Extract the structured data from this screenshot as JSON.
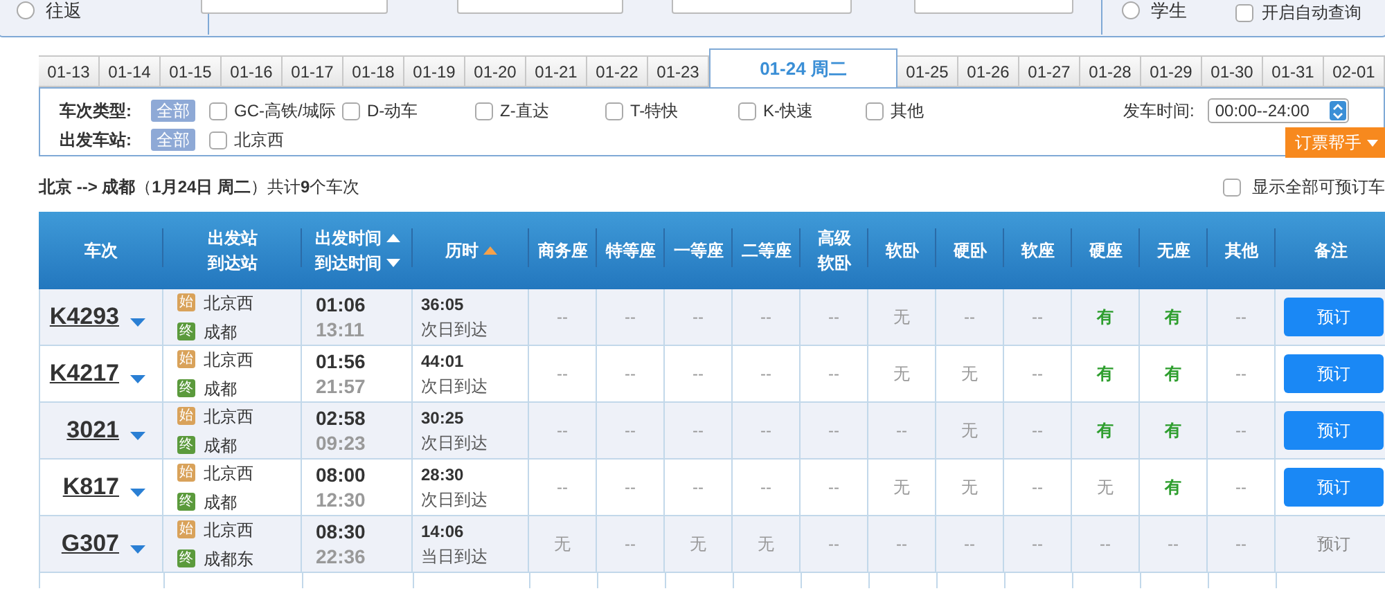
{
  "search_form": {
    "trip_radio": {
      "label": "往返",
      "selected": false
    },
    "passenger_radio": {
      "label": "学生",
      "selected": false
    },
    "auto_query": {
      "label": "开启自动查询",
      "checked": false
    }
  },
  "date_tabs": [
    {
      "label": "01-13",
      "selected": false
    },
    {
      "label": "01-14",
      "selected": false
    },
    {
      "label": "01-15",
      "selected": false
    },
    {
      "label": "01-16",
      "selected": false
    },
    {
      "label": "01-17",
      "selected": false
    },
    {
      "label": "01-18",
      "selected": false
    },
    {
      "label": "01-19",
      "selected": false
    },
    {
      "label": "01-20",
      "selected": false
    },
    {
      "label": "01-21",
      "selected": false
    },
    {
      "label": "01-22",
      "selected": false
    },
    {
      "label": "01-23",
      "selected": false
    },
    {
      "label": "01-24 周二",
      "selected": true
    },
    {
      "label": "01-25",
      "selected": false
    },
    {
      "label": "01-26",
      "selected": false
    },
    {
      "label": "01-27",
      "selected": false
    },
    {
      "label": "01-28",
      "selected": false
    },
    {
      "label": "01-29",
      "selected": false
    },
    {
      "label": "01-30",
      "selected": false
    },
    {
      "label": "01-31",
      "selected": false
    },
    {
      "label": "02-01",
      "selected": false
    }
  ],
  "filters": {
    "train_type": {
      "label": "车次类型:",
      "all": {
        "label": "全部",
        "selected": true
      },
      "options": [
        {
          "label": "GC-高铁/城际",
          "checked": false
        },
        {
          "label": "D-动车",
          "checked": false
        },
        {
          "label": "Z-直达",
          "checked": false
        },
        {
          "label": "T-特快",
          "checked": false
        },
        {
          "label": "K-快速",
          "checked": false
        },
        {
          "label": "其他",
          "checked": false
        }
      ]
    },
    "station": {
      "label": "出发车站:",
      "all": {
        "label": "全部",
        "selected": true
      },
      "options": [
        {
          "label": "北京西",
          "checked": false
        }
      ]
    },
    "time": {
      "label": "发车时间:",
      "value": "00:00--24:00"
    },
    "helper_button": "订票帮手"
  },
  "summary": "**北京 --> 成都**（**1月24日 周二**）共计**9**个车次",
  "show_all": {
    "label": "显示全部可预订车",
    "checked": false
  },
  "table": {
    "columns": [
      {
        "lines": [
          "车次"
        ],
        "kind": "plain"
      },
      {
        "lines": [
          "出发站",
          "到达站"
        ],
        "kind": "plain"
      },
      {
        "lines": [
          "出发时间",
          "到达时间"
        ],
        "kind": "sortable"
      },
      {
        "lines": [
          "历时"
        ],
        "kind": "sorted"
      },
      {
        "lines": [
          "商务座"
        ],
        "kind": "plain"
      },
      {
        "lines": [
          "特等座"
        ],
        "kind": "plain"
      },
      {
        "lines": [
          "一等座"
        ],
        "kind": "plain"
      },
      {
        "lines": [
          "二等座"
        ],
        "kind": "plain"
      },
      {
        "lines": [
          "高级",
          "软卧"
        ],
        "kind": "plain"
      },
      {
        "lines": [
          "软卧"
        ],
        "kind": "plain"
      },
      {
        "lines": [
          "硬卧"
        ],
        "kind": "plain"
      },
      {
        "lines": [
          "软座"
        ],
        "kind": "plain"
      },
      {
        "lines": [
          "硬座"
        ],
        "kind": "plain"
      },
      {
        "lines": [
          "无座"
        ],
        "kind": "plain"
      },
      {
        "lines": [
          "其他"
        ],
        "kind": "plain"
      },
      {
        "lines": [
          "备注"
        ],
        "kind": "plain"
      }
    ],
    "rows": [
      {
        "train": "K4293",
        "from_tag": "始",
        "from": "北京西",
        "to_tag": "终",
        "to": "成都",
        "depart": "01:06",
        "arrive": "13:11",
        "duration": "36:05",
        "arrival_day": "次日到达",
        "seats": [
          {
            "text": "--",
            "available": false
          },
          {
            "text": "--",
            "available": false
          },
          {
            "text": "--",
            "available": false
          },
          {
            "text": "--",
            "available": false
          },
          {
            "text": "--",
            "available": false
          },
          {
            "text": "无",
            "available": false
          },
          {
            "text": "--",
            "available": false
          },
          {
            "text": "--",
            "available": false
          },
          {
            "text": "有",
            "available": true
          },
          {
            "text": "有",
            "available": true
          },
          {
            "text": "--",
            "available": false
          }
        ],
        "book": {
          "label": "预订",
          "disabled": false
        }
      },
      {
        "train": "K4217",
        "from_tag": "始",
        "from": "北京西",
        "to_tag": "终",
        "to": "成都",
        "depart": "01:56",
        "arrive": "21:57",
        "duration": "44:01",
        "arrival_day": "次日到达",
        "seats": [
          {
            "text": "--",
            "available": false
          },
          {
            "text": "--",
            "available": false
          },
          {
            "text": "--",
            "available": false
          },
          {
            "text": "--",
            "available": false
          },
          {
            "text": "--",
            "available": false
          },
          {
            "text": "无",
            "available": false
          },
          {
            "text": "无",
            "available": false
          },
          {
            "text": "--",
            "available": false
          },
          {
            "text": "有",
            "available": true
          },
          {
            "text": "有",
            "available": true
          },
          {
            "text": "--",
            "available": false
          }
        ],
        "book": {
          "label": "预订",
          "disabled": false
        }
      },
      {
        "train": "3021",
        "from_tag": "始",
        "from": "北京西",
        "to_tag": "终",
        "to": "成都",
        "depart": "02:58",
        "arrive": "09:23",
        "duration": "30:25",
        "arrival_day": "次日到达",
        "seats": [
          {
            "text": "--",
            "available": false
          },
          {
            "text": "--",
            "available": false
          },
          {
            "text": "--",
            "available": false
          },
          {
            "text": "--",
            "available": false
          },
          {
            "text": "--",
            "available": false
          },
          {
            "text": "--",
            "available": false
          },
          {
            "text": "无",
            "available": false
          },
          {
            "text": "--",
            "available": false
          },
          {
            "text": "有",
            "available": true
          },
          {
            "text": "有",
            "available": true
          },
          {
            "text": "--",
            "available": false
          }
        ],
        "book": {
          "label": "预订",
          "disabled": false
        }
      },
      {
        "train": "K817",
        "from_tag": "始",
        "from": "北京西",
        "to_tag": "终",
        "to": "成都",
        "depart": "08:00",
        "arrive": "12:30",
        "duration": "28:30",
        "arrival_day": "次日到达",
        "seats": [
          {
            "text": "--",
            "available": false
          },
          {
            "text": "--",
            "available": false
          },
          {
            "text": "--",
            "available": false
          },
          {
            "text": "--",
            "available": false
          },
          {
            "text": "--",
            "available": false
          },
          {
            "text": "无",
            "available": false
          },
          {
            "text": "无",
            "available": false
          },
          {
            "text": "--",
            "available": false
          },
          {
            "text": "无",
            "available": false
          },
          {
            "text": "有",
            "available": true
          },
          {
            "text": "--",
            "available": false
          }
        ],
        "book": {
          "label": "预订",
          "disabled": false
        }
      },
      {
        "train": "G307",
        "from_tag": "始",
        "from": "北京西",
        "to_tag": "终",
        "to": "成都东",
        "depart": "08:30",
        "arrive": "22:36",
        "duration": "14:06",
        "arrival_day": "当日到达",
        "seats": [
          {
            "text": "无",
            "available": false
          },
          {
            "text": "--",
            "available": false
          },
          {
            "text": "无",
            "available": false
          },
          {
            "text": "无",
            "available": false
          },
          {
            "text": "--",
            "available": false
          },
          {
            "text": "--",
            "available": false
          },
          {
            "text": "--",
            "available": false
          },
          {
            "text": "--",
            "available": false
          },
          {
            "text": "--",
            "available": false
          },
          {
            "text": "--",
            "available": false
          },
          {
            "text": "--",
            "available": false
          }
        ],
        "book": {
          "label": "预订",
          "disabled": true
        }
      }
    ]
  }
}
